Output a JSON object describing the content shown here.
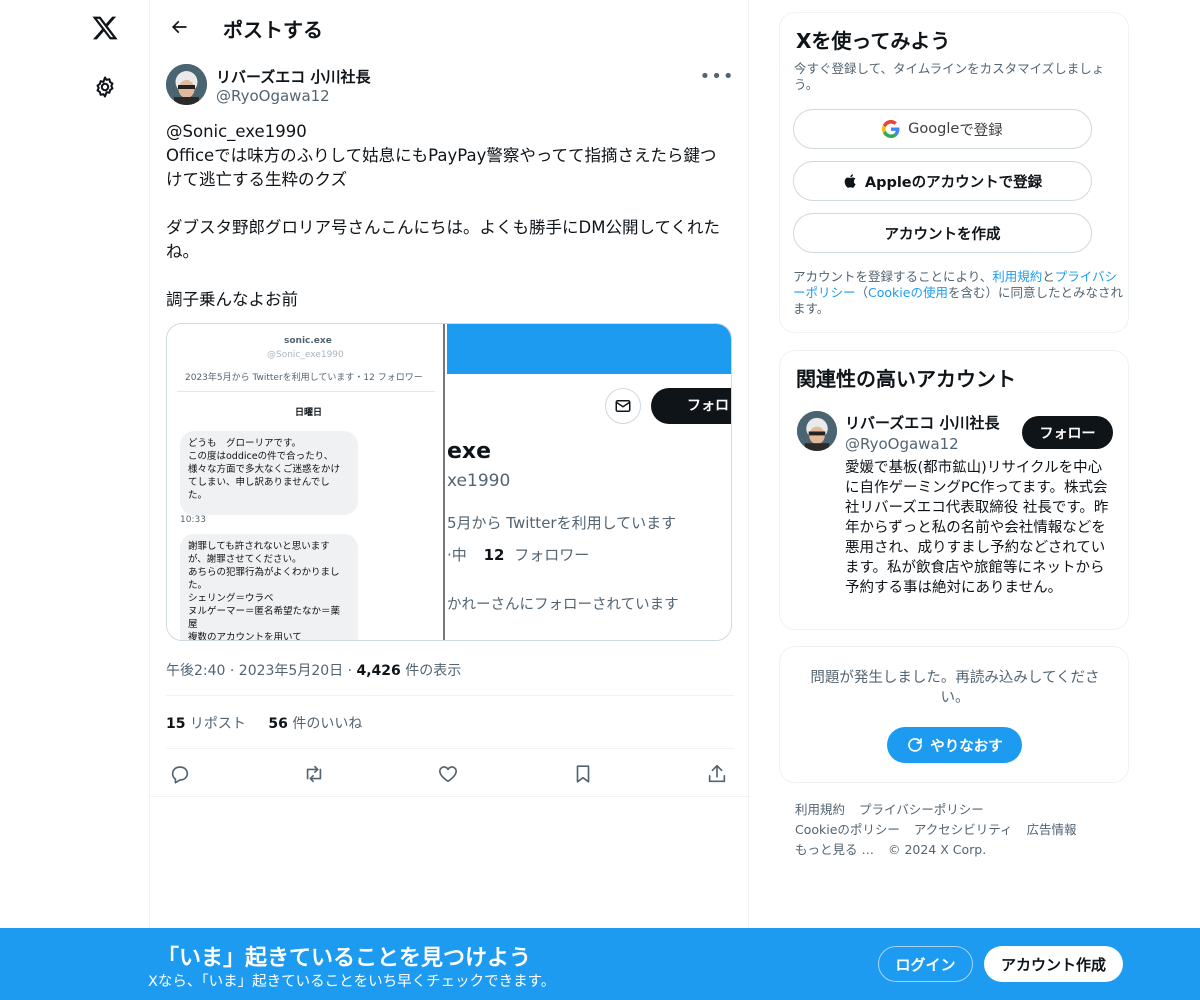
{
  "nav": {
    "logo_icon": "x-logo-icon",
    "settings_icon": "gear-icon"
  },
  "header": {
    "title": "ポストする"
  },
  "post": {
    "author_name": "リバーズエコ 小川社長",
    "author_handle": "@RyoOgawa12",
    "text": "@Sonic_exe1990\nOfficeでは味方のふりして姑息にもPayPay警察やってて指摘さえたら鍵つけて逃亡する生粋のクズ\n\nダブスタ野郎グロリア号さんこんにちは。よくも勝手にDM公開してくれたね。\n\n調子乗んなよお前",
    "media": {
      "left": {
        "profile_name": "sonic.exe",
        "profile_handle": "@Sonic_exe1990",
        "profile_info": "2023年5月から Twitterを利用しています・12 フォロワー",
        "day_label": "日曜日",
        "bubble1": "どうも　グローリアです。\nこの度はoddiceの件で合ったり、\n様々な方面で多大なくご迷惑をかけ\nてしまい、申し訳ありませんでし\nた。",
        "time1": "10:33",
        "bubble2": "謝罪しても許されないと思います\nが、謝罪させてください。\nあちらの犯罪行為がよくわかりまし\nた。\nシェリング＝ウラベ\nヌルゲーマー＝匿名希望たなか＝薬\n屋\n複数のアカウントを用いて"
      },
      "right": {
        "follow_label": "フォロ",
        "name": "exe",
        "handle": "xe1990",
        "joined": "5月から Twitterを利用しています",
        "following_prefix": "·中",
        "following_count": "12",
        "following_suffix": "フォロワー",
        "followed_by": "かれーさんにフォローされています"
      }
    },
    "timestamp": "午後2:40 · 2023年5月20日 · ",
    "views_count": "4,426",
    "views_label": " 件の表示",
    "reposts_count": "15",
    "reposts_label": " リポスト",
    "likes_count": "56",
    "likes_label": " 件のいいね"
  },
  "signup": {
    "title": "Xを使ってみよう",
    "subtitle": "今すぐ登録して、タイムラインをカスタマイズしましょう。",
    "google_brand": "Google",
    "google_suffix": " で登録",
    "apple_label": "Appleのアカウントで登録",
    "create_label": "アカウントを作成",
    "terms_prefix": "アカウントを登録することにより、",
    "terms_link1": "利用規約",
    "terms_and": "と",
    "terms_link2": "プライバシーポリシー",
    "terms_mid": "（",
    "terms_link3": "Cookieの使用",
    "terms_suffix": "を含む）に同意したとみなされます。"
  },
  "related": {
    "title": "関連性の高いアカウント",
    "name": "リバーズエコ 小川社長",
    "handle": "@RyoOgawa12",
    "follow_label": "フォロー",
    "bio": "愛媛で基板(都市鉱山)リサイクルを中心に自作ゲーミングPC作ってます。株式会社リバーズエコ代表取締役 社長です。昨年からずっと私の名前や会社情報などを悪用され、成りすまし予約などされています。私が飲食店や旅館等にネットから予約する事は絶対にありません。"
  },
  "error_card": {
    "message": "問題が発生しました。再読み込みしてください。",
    "retry_label": "やりなおす"
  },
  "footer": {
    "links": [
      "利用規約",
      "プライバシーポリシー",
      "Cookieのポリシー",
      "アクセシビリティ",
      "広告情報",
      "もっと見る …"
    ],
    "copyright": "© 2024 X Corp."
  },
  "bottom_bar": {
    "title": "「いま」起きていることを見つけよう",
    "subtitle": "Xなら、「いま」起きていることをいち早くチェックできます。",
    "login_label": "ログイン",
    "create_label": "アカウント作成"
  },
  "colors": {
    "accent": "#1d9bf0",
    "text": "#0f1419",
    "muted": "#536471",
    "border": "#eff3f4"
  }
}
